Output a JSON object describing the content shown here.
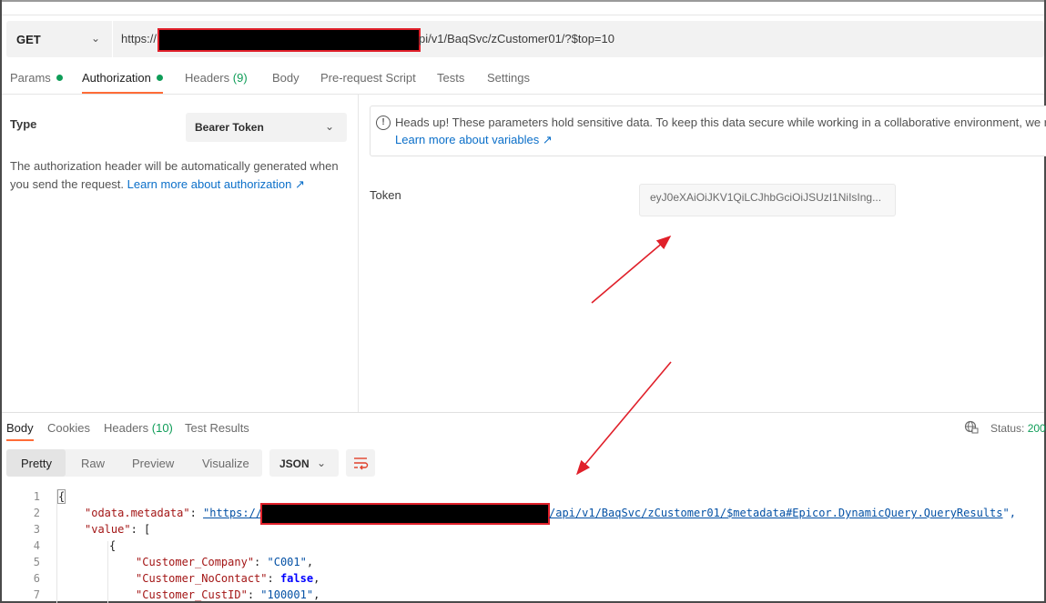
{
  "request": {
    "method": "GET",
    "url_prefix": "https://",
    "url_suffix": "pi/v1/BaqSvc/zCustomer01/?$top=10"
  },
  "request_tabs": {
    "params": "Params",
    "authorization": "Authorization",
    "headers": "Headers",
    "headers_count": "(9)",
    "body": "Body",
    "prerequest": "Pre-request Script",
    "tests": "Tests",
    "settings": "Settings"
  },
  "auth": {
    "type_label": "Type",
    "type_value": "Bearer Token",
    "description": "The authorization header will be automatically generated when you send the request.",
    "learn_link": "Learn more about authorization ↗",
    "notice_text": "Heads up! These parameters hold sensitive data. To keep this data secure while working in a collaborative environment, we rec",
    "notice_link": "Learn more about variables ↗",
    "token_label": "Token",
    "token_value": "eyJ0eXAiOiJKV1QiLCJhbGciOiJSUzI1NiIsIng..."
  },
  "response_tabs": {
    "body": "Body",
    "cookies": "Cookies",
    "headers": "Headers",
    "headers_count": "(10)",
    "test_results": "Test Results",
    "status_label": "Status:",
    "status_value": "200"
  },
  "format": {
    "pretty": "Pretty",
    "raw": "Raw",
    "preview": "Preview",
    "visualize": "Visualize",
    "language": "JSON"
  },
  "code": {
    "line_numbers": [
      "1",
      "2",
      "3",
      "4",
      "5",
      "6",
      "7"
    ],
    "l1": "{",
    "l2_key": "\"odata.metadata\"",
    "l2_colon": ": ",
    "l2_url_a": "\"https://",
    "l2_url_b": "/api/v1/BaqSvc/zCustomer01/$metadata#Epicor.DynamicQuery.QueryResults",
    "l2_end": "\",",
    "l3_key": "\"value\"",
    "l3_rest": ": [",
    "l4": "{",
    "l5_key": "\"Customer_Company\"",
    "l5_colon": ": ",
    "l5_val": "\"C001\"",
    "l5_end": ",",
    "l6_key": "\"Customer_NoContact\"",
    "l6_colon": ": ",
    "l6_val": "false",
    "l6_end": ",",
    "l7_key": "\"Customer_CustID\"",
    "l7_colon": ": ",
    "l7_val": "\"100001\"",
    "l7_end": ","
  },
  "colors": {
    "accent": "#ff6c37",
    "success": "#0f9d58",
    "link": "#0b6fc9",
    "annotation": "#e0202a"
  }
}
